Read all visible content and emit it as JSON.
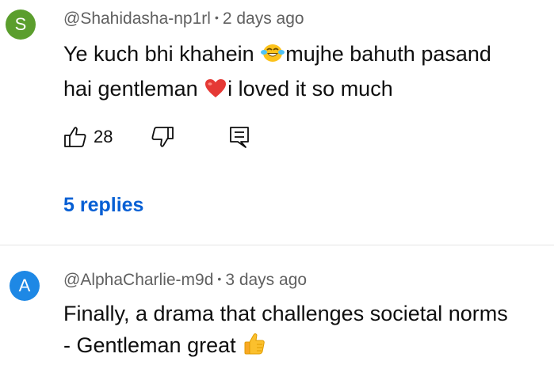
{
  "comments": [
    {
      "avatar_letter": "S",
      "avatar_color": "#5b9e2d",
      "author": "@Shahidasha-np1rl",
      "separator": "•",
      "time": "2 days ago",
      "line1_a": "Ye kuch bhi khahein ",
      "line1_b": "mujhe bahuth pasand",
      "line2_a": "hai gentleman ",
      "line2_b": "i loved it so much",
      "likes": "28",
      "replies_label": "5 replies",
      "emojis": [
        "laughing-tears-emoji",
        "red-heart-emoji"
      ]
    },
    {
      "avatar_letter": "A",
      "avatar_color": "#1e88e5",
      "author": "@AlphaCharlie-m9d",
      "separator": "•",
      "time": "3 days ago",
      "line1": "Finally, a drama that challenges societal norms",
      "line2": "- Gentleman great ",
      "emojis": [
        "thumbs-up-emoji"
      ]
    }
  ],
  "icons": {
    "like": "thumbs-up-icon",
    "dislike": "thumbs-down-icon",
    "reply": "comment-reply-icon"
  },
  "colors": {
    "link": "#065fd4",
    "meta": "#606060",
    "text": "#0f0f0f"
  }
}
